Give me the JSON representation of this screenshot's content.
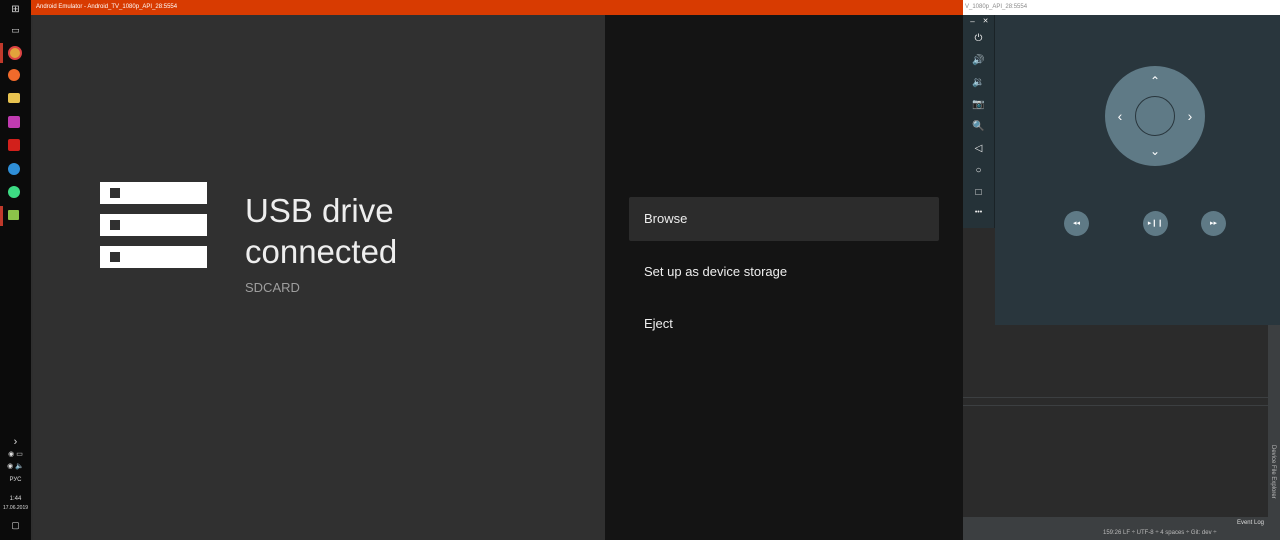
{
  "emulator": {
    "title": "Android Emulator - Android_TV_1080p_API_28:5554",
    "usb_title_line1": "USB drive",
    "usb_title_line2": "connected",
    "usb_subtitle": "SDCARD",
    "menu": [
      {
        "label": "Browse",
        "focused": true
      },
      {
        "label": "Set up as device storage",
        "focused": false
      },
      {
        "label": "Eject",
        "focused": false
      }
    ]
  },
  "controls": {
    "title": "V_1080p_API_28:5554",
    "minimize_glyph": "–",
    "close_glyph": "✕",
    "toolbar_icons": [
      "power-icon",
      "volume-up-icon",
      "volume-down-icon",
      "camera-icon",
      "zoom-icon",
      "back-icon",
      "home-icon",
      "overview-icon",
      "more-icon"
    ],
    "toolbar_glyphs": [
      "⏻",
      "🔊",
      "🔉",
      "📷",
      "🔍",
      "◁",
      "○",
      "□",
      "•••"
    ],
    "dpad": {
      "up": "⌃",
      "down": "⌄",
      "left": "‹",
      "right": "›"
    },
    "media": {
      "rewind": "◂◂",
      "play_pause": "▸❙❙",
      "fast_forward": "▸▸"
    }
  },
  "taskbar": {
    "language": "РУС",
    "time": "1:44",
    "date": "17.06.2019",
    "chevron": "›"
  },
  "ide": {
    "event_log": "Event Log",
    "status": "159:26  LF ÷  UTF-8 ÷  4 spaces ÷  Git: dev ÷",
    "side_label": "Device File Explorer"
  }
}
